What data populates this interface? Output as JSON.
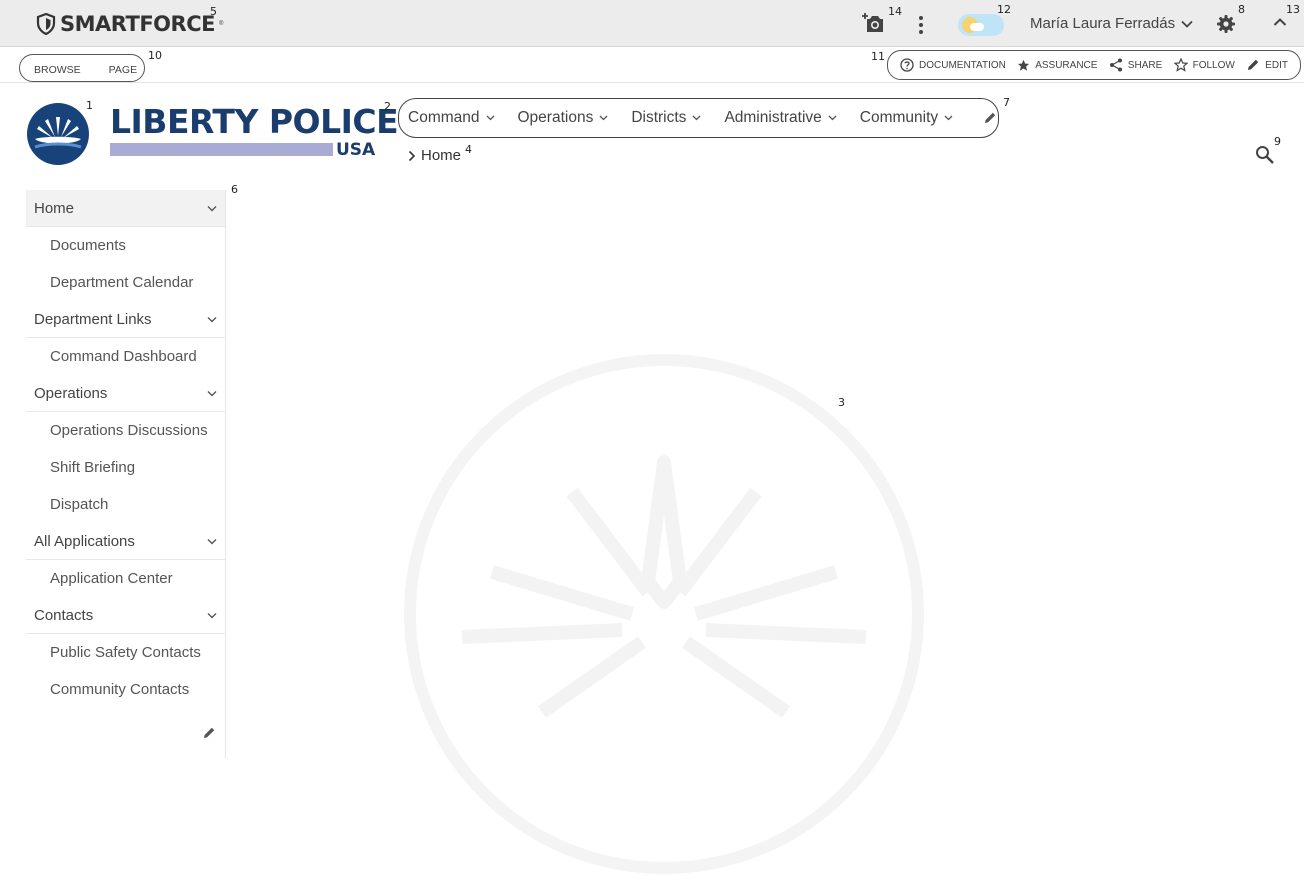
{
  "brand": {
    "name": "SMARTFORCE",
    "mark": "®"
  },
  "user": {
    "name": "María Laura Ferradás"
  },
  "subbar": {
    "browse_label": "BROWSE",
    "page_label": "PAGE",
    "actions": [
      {
        "label": "DOCUMENTATION",
        "icon": "help-circle-icon"
      },
      {
        "label": "ASSURANCE",
        "icon": "star-solid-icon"
      },
      {
        "label": "SHARE",
        "icon": "share-icon"
      },
      {
        "label": "FOLLOW",
        "icon": "star-outline-icon"
      },
      {
        "label": "EDIT",
        "icon": "pencil-icon"
      }
    ]
  },
  "logo": {
    "main": "LIBERTY POLICE",
    "sub": "USA"
  },
  "nav": {
    "items": [
      {
        "label": "Command"
      },
      {
        "label": "Operations"
      },
      {
        "label": "Districts"
      },
      {
        "label": "Administrative"
      },
      {
        "label": "Community"
      }
    ]
  },
  "breadcrumb": {
    "current": "Home"
  },
  "sidebar": {
    "groups": [
      {
        "label": "Home",
        "items": [
          "Documents",
          "Department Calendar"
        ]
      },
      {
        "label": "Department Links",
        "items": [
          "Command Dashboard"
        ]
      },
      {
        "label": "Operations",
        "items": [
          "Operations Discussions",
          "Shift Briefing",
          "Dispatch"
        ]
      },
      {
        "label": "All Applications",
        "items": [
          "Application Center"
        ]
      },
      {
        "label": "Contacts",
        "items": [
          "Public Safety Contacts",
          "Community Contacts"
        ]
      }
    ]
  },
  "annotations": [
    "1",
    "2",
    "3",
    "4",
    "5",
    "6",
    "7",
    "8",
    "9",
    "10",
    "11",
    "12",
    "13",
    "14"
  ],
  "colors": {
    "brand_navy": "#1a3d6e",
    "logo_bar": "#a8acd4",
    "topbar_bg": "#ececec",
    "seal": "#18437a"
  }
}
